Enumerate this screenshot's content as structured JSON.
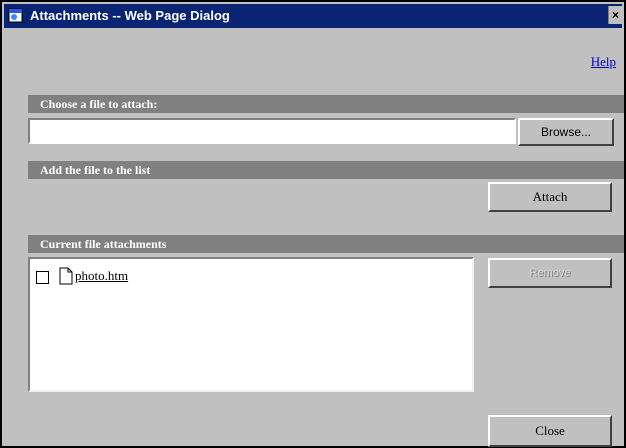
{
  "window": {
    "title": "Attachments -- Web Page Dialog",
    "close_glyph": "×"
  },
  "help": {
    "label": "Help"
  },
  "sections": {
    "choose": "Choose a file to attach:",
    "add": "Add the file to the list",
    "current": "Current file attachments"
  },
  "file_input": {
    "value": ""
  },
  "buttons": {
    "browse": "Browse...",
    "attach": "Attach",
    "remove": "Remove",
    "close": "Close"
  },
  "attachments": [
    {
      "name": "photo.htm",
      "checked": false
    }
  ],
  "icons": {
    "app": "ie-page-icon",
    "file": "document-icon"
  }
}
